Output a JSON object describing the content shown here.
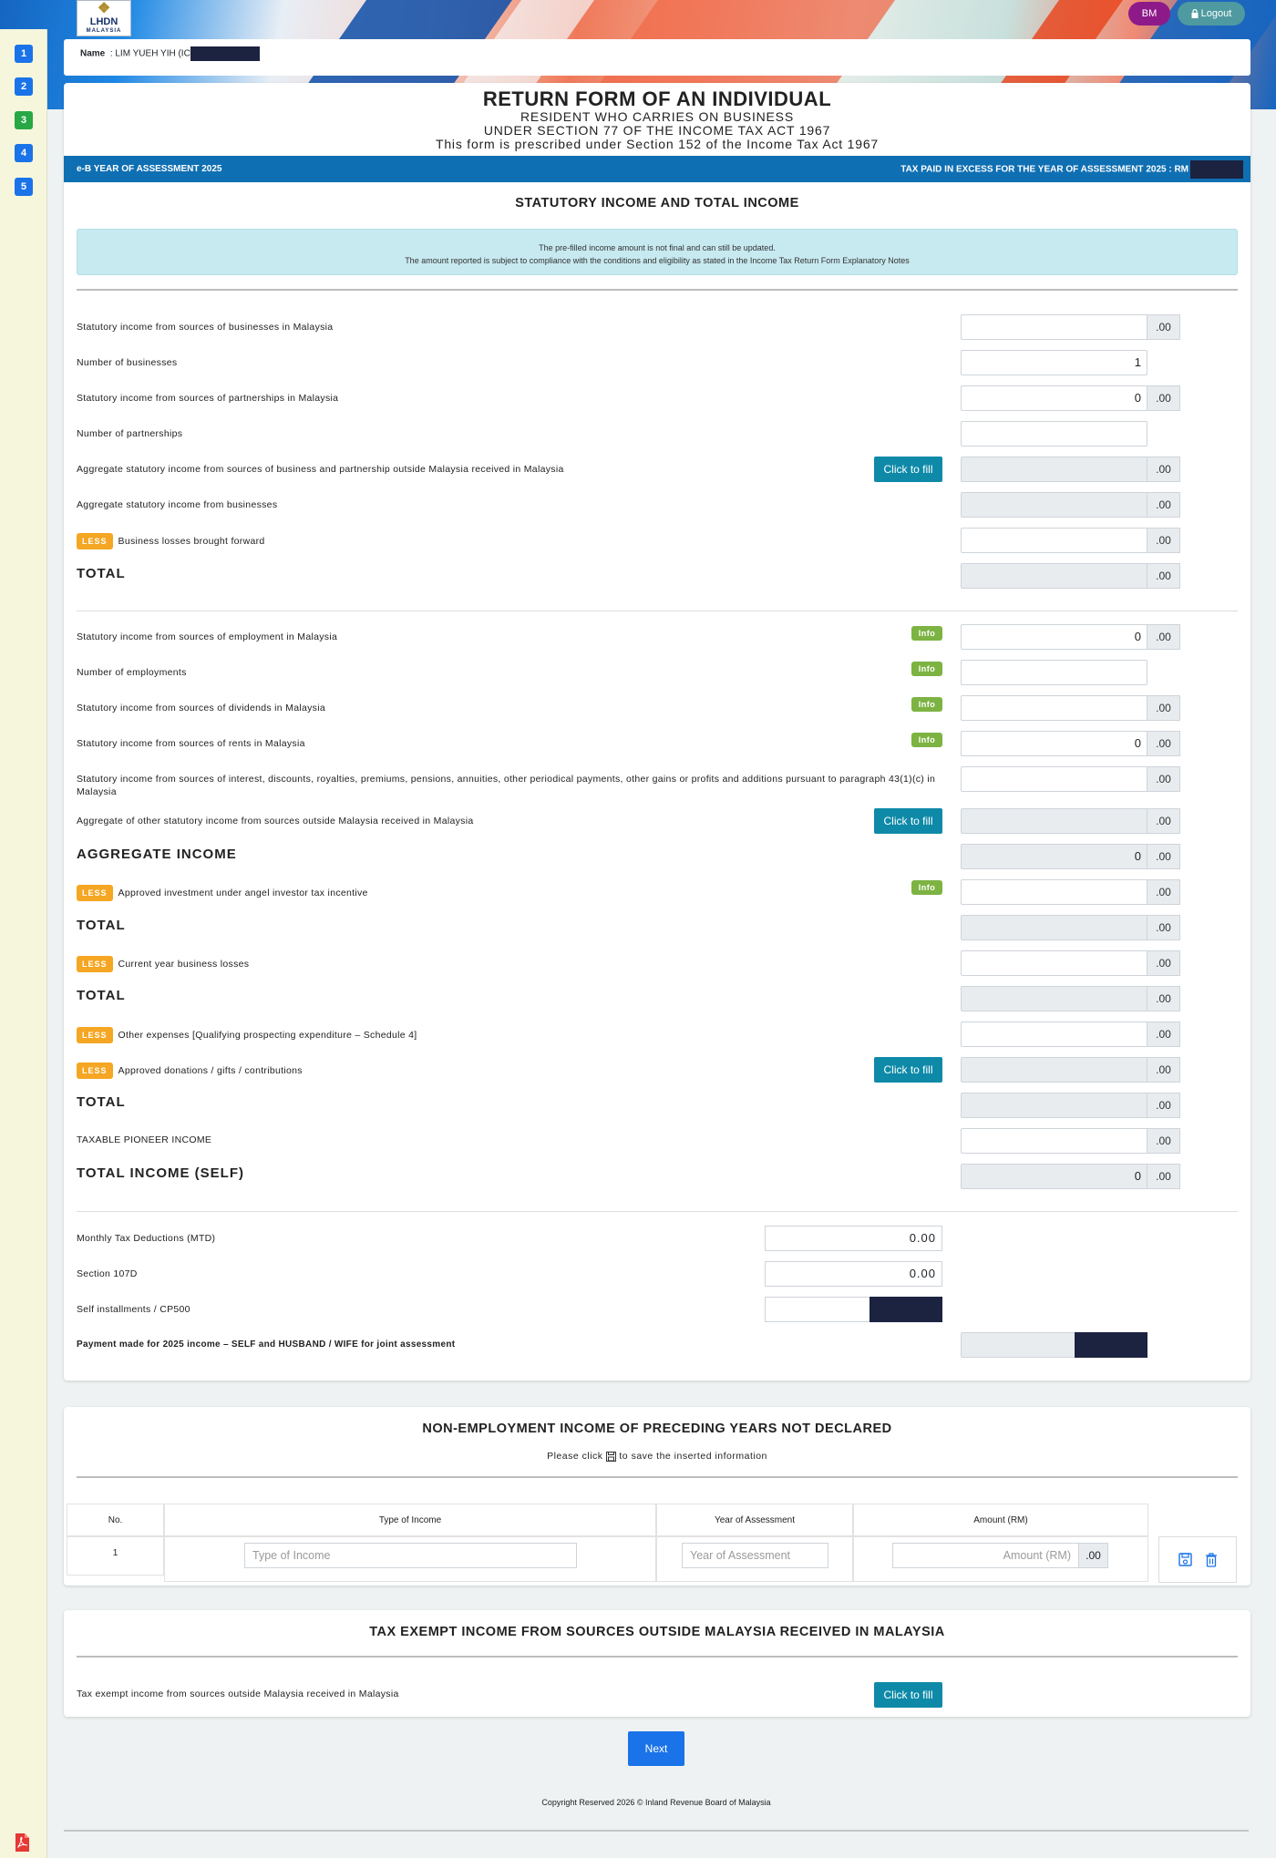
{
  "header": {
    "logo_text": "LHDN",
    "logo_sub": "MALAYSIA",
    "lang_button": "BM",
    "logout_label": "Logout"
  },
  "sidebar": {
    "steps": [
      "1",
      "2",
      "3",
      "4",
      "5"
    ],
    "active_step": "3"
  },
  "namebar": {
    "label": "Name",
    "value": ": LIM YUEH YIH (IC"
  },
  "form": {
    "title": "RETURN FORM OF AN INDIVIDUAL",
    "sub1": "RESIDENT WHO CARRIES ON BUSINESS",
    "sub2": "UNDER SECTION 77 OF THE INCOME TAX ACT 1967",
    "sub3": "This form is prescribed under Section 152 of the Income Tax Act 1967",
    "bar_left": "e-B YEAR OF ASSESSMENT 2025",
    "bar_right": "TAX PAID IN EXCESS FOR THE YEAR OF ASSESSMENT 2025 : RM"
  },
  "statutory": {
    "title": "STATUTORY INCOME AND TOTAL INCOME",
    "notice1": "The pre-filled income amount is not final and can still be updated.",
    "notice2": "The amount reported is subject to compliance with the conditions and eligibility as stated in the Income Tax Return Form Explanatory Notes",
    "less_tag": "LESS",
    "info_tag": "Info",
    "fill_label": "Click to fill",
    "decimal": ".00",
    "rows": {
      "r1": {
        "label": "Statutory income from sources of businesses in Malaysia",
        "value": ""
      },
      "r2": {
        "label": "Number of businesses",
        "value": "1"
      },
      "r3": {
        "label": "Statutory income from sources of partnerships in Malaysia",
        "value": "0"
      },
      "r4": {
        "label": "Number of partnerships",
        "value": ""
      },
      "r5": {
        "label": "Aggregate statutory income from sources of business and partnership outside Malaysia received in Malaysia",
        "value": ""
      },
      "r6": {
        "label": "Aggregate statutory income from businesses",
        "value": ""
      },
      "r7": {
        "label": "Business losses brought forward",
        "value": ""
      },
      "r8": {
        "label": "TOTAL",
        "value": ""
      },
      "r9": {
        "label": "Statutory income from sources of employment in Malaysia",
        "value": "0"
      },
      "r10": {
        "label": "Number of employments",
        "value": ""
      },
      "r11": {
        "label": "Statutory income from sources of dividends in Malaysia",
        "value": ""
      },
      "r12": {
        "label": "Statutory income from sources of rents in Malaysia",
        "value": "0"
      },
      "r13a": {
        "label": "Statutory income from sources of interest, discounts, royalties, premiums, pensions, annuities, other periodical payments, other gains or profits and additions pursuant to paragraph"
      },
      "r13b": {
        "label": "43(1)(c) in Malaysia",
        "value": ""
      },
      "r14": {
        "label": "Aggregate of other statutory income from sources outside Malaysia received in Malaysia",
        "value": ""
      },
      "r15": {
        "label": "AGGREGATE INCOME",
        "value": "0"
      },
      "r16": {
        "label": "Approved investment under angel investor tax incentive",
        "value": ""
      },
      "r17": {
        "label": "TOTAL",
        "value": ""
      },
      "r18": {
        "label": "Current year business losses",
        "value": ""
      },
      "r19": {
        "label": "TOTAL",
        "value": ""
      },
      "r20": {
        "label": "Other expenses [Qualifying prospecting expenditure – Schedule 4]",
        "value": ""
      },
      "r21": {
        "label": "Approved donations / gifts / contributions",
        "value": ""
      },
      "r22": {
        "label": "TOTAL",
        "value": ""
      },
      "r23": {
        "label": "TAXABLE PIONEER INCOME",
        "value": ""
      },
      "r24": {
        "label": "TOTAL INCOME (SELF)",
        "value": "0"
      },
      "r25": {
        "label": "Monthly Tax Deductions (MTD)",
        "value": "0.00"
      },
      "r26": {
        "label": "Section 107D",
        "value": "0.00"
      },
      "r27": {
        "label": "Self installments / CP500",
        "value": ""
      },
      "r28": {
        "label": "Payment made for 2025 income – SELF and HUSBAND / WIFE for joint assessment",
        "value": ""
      }
    }
  },
  "non_employment": {
    "title": "NON-EMPLOYMENT INCOME OF PRECEDING YEARS NOT DECLARED",
    "instr_pre": "Please click",
    "instr_post": "to save the inserted information",
    "columns": [
      "No.",
      "Type of Income",
      "Year of Assessment",
      "Amount (RM)"
    ],
    "row_no": "1",
    "ph_type": "Type of Income",
    "ph_year": "Year of Assessment",
    "ph_amount": "Amount (RM)",
    "decimal": ".00"
  },
  "tax_exempt": {
    "title": "TAX EXEMPT INCOME FROM SOURCES OUTSIDE MALAYSIA RECEIVED IN MALAYSIA",
    "label": "Tax exempt income from sources outside Malaysia received in Malaysia",
    "fill_label": "Click to fill"
  },
  "footer": {
    "next_label": "Next",
    "copyright": "Copyright Reserved 2026 © Inland Revenue Board of Malaysia"
  },
  "colors": {
    "primary": "#1a73e8",
    "form_bar": "#0f6fb3",
    "fill_button": "#0e8aa8",
    "less_tag": "#f5a623",
    "info_tag": "#7cb342"
  }
}
